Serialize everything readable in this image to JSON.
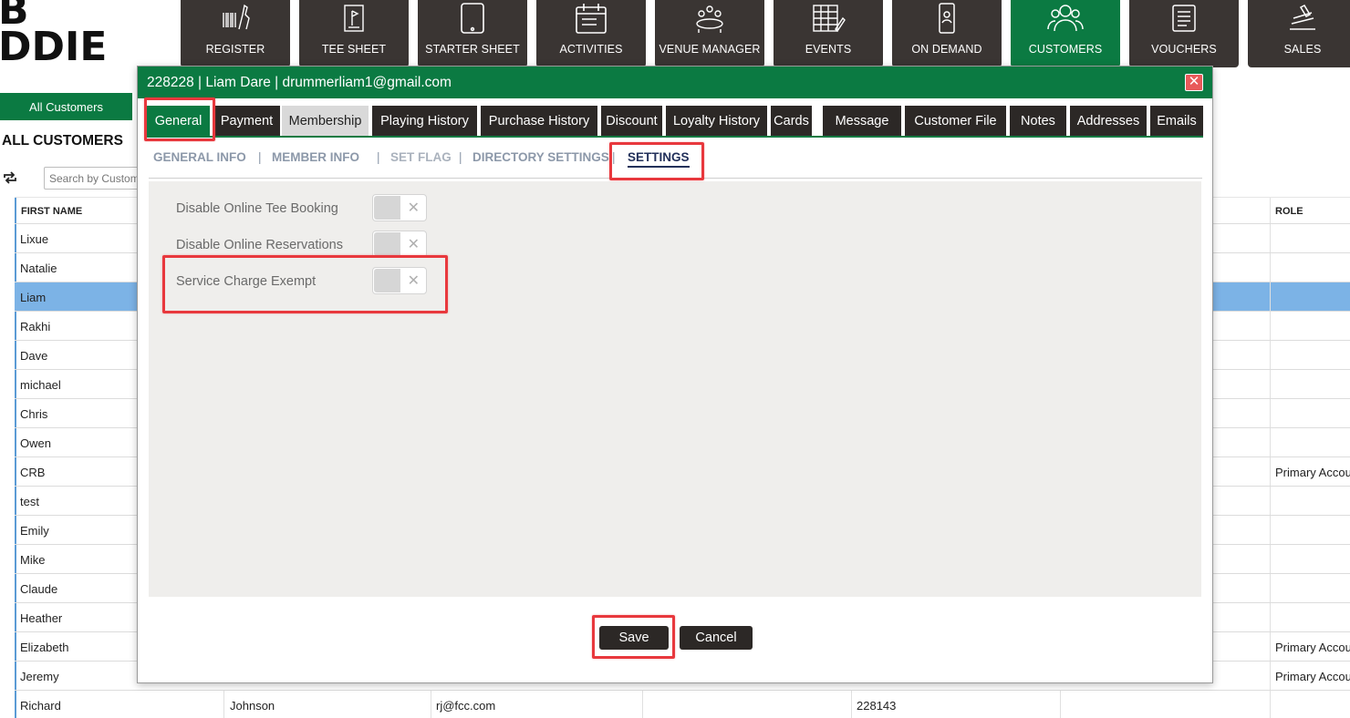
{
  "logo": {
    "line1": "B",
    "line2": "DDIE"
  },
  "nav": [
    {
      "label": "REGISTER",
      "icon": "barcode-icon"
    },
    {
      "label": "TEE SHEET",
      "icon": "tee-sheet-icon"
    },
    {
      "label": "STARTER SHEET",
      "icon": "tablet-icon"
    },
    {
      "label": "ACTIVITIES",
      "icon": "calendar-icon"
    },
    {
      "label": "VENUE MANAGER",
      "icon": "venue-icon"
    },
    {
      "label": "EVENTS",
      "icon": "events-icon"
    },
    {
      "label": "ON DEMAND",
      "icon": "phone-icon"
    },
    {
      "label": "CUSTOMERS",
      "icon": "customers-icon",
      "active": true
    },
    {
      "label": "VOUCHERS",
      "icon": "vouchers-icon"
    },
    {
      "label": "SALES",
      "icon": "sales-icon"
    }
  ],
  "page": {
    "tab_label": "All Customers",
    "title": "ALL CUSTOMERS",
    "search_placeholder": "Search by Customer"
  },
  "grid": {
    "columns": {
      "first_name": "FIRST NAME",
      "role": "ROLE"
    },
    "rows": [
      {
        "first": "Lixue",
        "role": ""
      },
      {
        "first": "Natalie",
        "role": ""
      },
      {
        "first": "Liam",
        "role": "",
        "selected": true
      },
      {
        "first": "Rakhi",
        "role": ""
      },
      {
        "first": "Dave",
        "role": ""
      },
      {
        "first": "michael",
        "role": ""
      },
      {
        "first": "Chris",
        "role": ""
      },
      {
        "first": "Owen",
        "role": ""
      },
      {
        "first": "CRB",
        "role": "Primary Account"
      },
      {
        "first": "test",
        "role": ""
      },
      {
        "first": "Emily",
        "role": ""
      },
      {
        "first": "Mike",
        "role": ""
      },
      {
        "first": "Claude",
        "role": ""
      },
      {
        "first": "Heather",
        "role": ""
      },
      {
        "first": "Elizabeth",
        "role": "Primary Account"
      },
      {
        "first": "Jeremy",
        "role": "Primary Account"
      },
      {
        "first": "Richard",
        "last": "Johnson",
        "email": "rj@fcc.com",
        "id": "228143",
        "role": ""
      }
    ]
  },
  "modal": {
    "title": "228228 | Liam Dare | drummerliam1@gmail.com",
    "close": "✕",
    "tabs": [
      "General",
      "Payment",
      "Membership",
      "Playing History",
      "Purchase History",
      "Discount",
      "Loyalty History",
      "Cards",
      "Message",
      "Customer File",
      "Notes",
      "Addresses",
      "Emails"
    ],
    "subnav": [
      "GENERAL INFO",
      "MEMBER INFO",
      "SET FLAG",
      "DIRECTORY SETTINGS",
      "SETTINGS"
    ],
    "separator": "|",
    "settings": [
      {
        "label": "Disable Online Tee Booking",
        "state": "off"
      },
      {
        "label": "Disable Online Reservations",
        "state": "off"
      },
      {
        "label": "Service Charge Exempt",
        "state": "off"
      }
    ],
    "toggle_off_glyph": "✕",
    "save": "Save",
    "cancel": "Cancel"
  },
  "colors": {
    "brand_green": "#0b7a42",
    "dark_tile": "#3a3533",
    "highlight_red": "#e8383d",
    "row_selected": "#7cb3e6"
  }
}
